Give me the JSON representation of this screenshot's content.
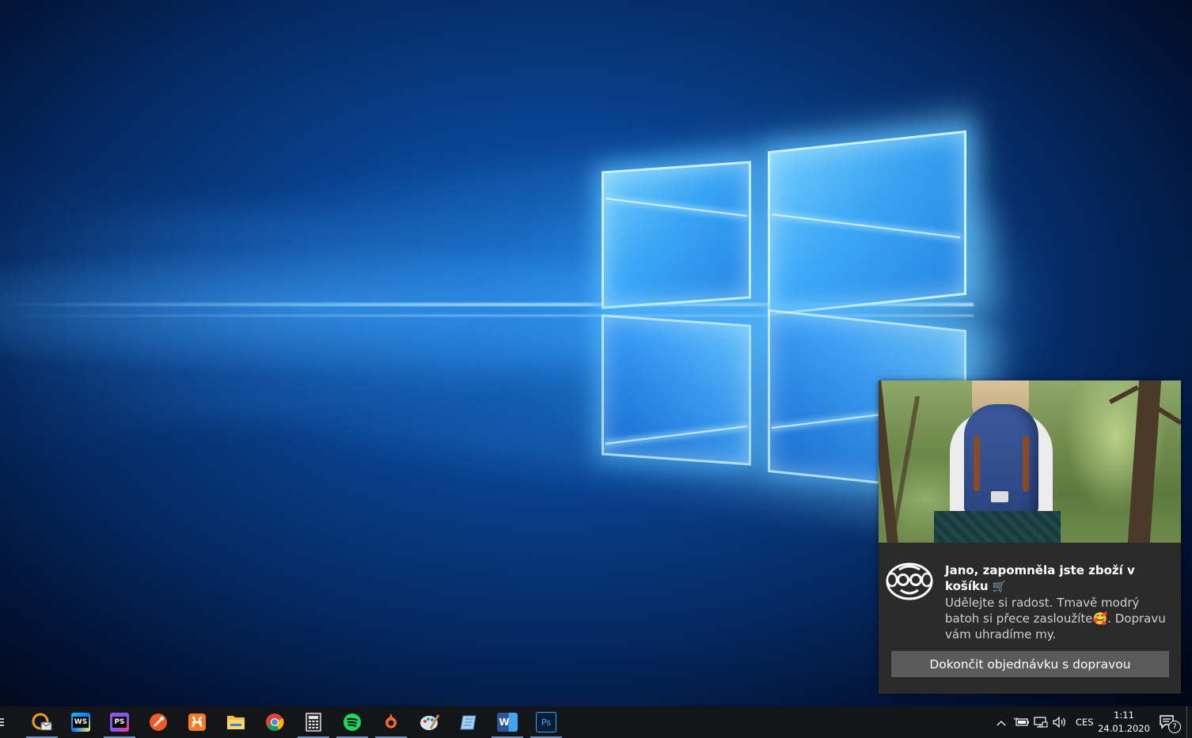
{
  "toast": {
    "title": "Jano, zapomněla jste zboží v košíku",
    "title_emoji": "🛒",
    "message_part1": "Udělejte si radost. Tmavě modrý batoh si přece zasloužíte",
    "message_emoji": "🥰",
    "message_part2": ". Dopravu vám uhradíme my.",
    "action_label": "Dokončit objednávku s dopravou",
    "hero_image": "woman-with-blue-backpack-in-forest",
    "app_logo": "monkey-with-glasses-logo"
  },
  "taskbar": {
    "task_view_icon": "task-view-icon",
    "apps": [
      {
        "name": "mail-client-icon",
        "color": "#f0a020"
      },
      {
        "name": "webstorm-icon",
        "label": "WS",
        "color": "#1b1f2a"
      },
      {
        "name": "phpstorm-icon",
        "label": "PS",
        "color": "#7b3fbf"
      },
      {
        "name": "postman-icon",
        "color": "#ef5b25"
      },
      {
        "name": "xampp-icon",
        "color": "#fb7a24"
      },
      {
        "name": "file-explorer-icon",
        "color": "#f8c33b"
      },
      {
        "name": "chrome-icon",
        "color": "#4285f4"
      },
      {
        "name": "calculator-icon",
        "color": "#d8d8d8"
      },
      {
        "name": "spotify-icon",
        "color": "#1ed760"
      },
      {
        "name": "origin-icon",
        "color": "#f56c2d"
      },
      {
        "name": "paint-icon",
        "color": "#7aa7d8"
      },
      {
        "name": "notepad-icon",
        "color": "#9ed3f5"
      },
      {
        "name": "word-icon",
        "label": "W",
        "color": "#2b579a"
      },
      {
        "name": "photoshop-icon",
        "label": "Ps",
        "color": "#001e36"
      }
    ],
    "tray": {
      "chevron_icon": "chevron-up-icon",
      "power_icon": "battery-plug-icon",
      "network_icon": "network-icon",
      "volume_icon": "volume-icon",
      "language": "CES",
      "time": "1:11",
      "date": "24.01.2020",
      "notification_count": "7"
    }
  }
}
